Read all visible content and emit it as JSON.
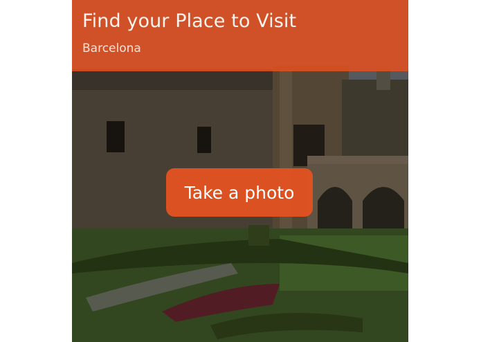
{
  "header": {
    "title": "Find your Place to Visit",
    "subtitle": "Barcelona"
  },
  "actions": {
    "take_photo_label": "Take a photo"
  },
  "colors": {
    "accent": "#e4501e",
    "button": "#e85220"
  }
}
